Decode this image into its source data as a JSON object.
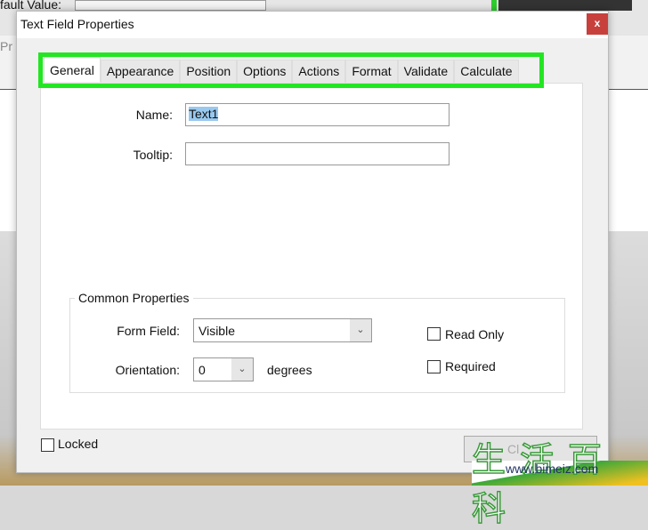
{
  "background": {
    "label": "fault Value:",
    "partial": "Pr"
  },
  "dialog": {
    "title": "Text Field Properties",
    "close_glyph": "x",
    "tabs": [
      {
        "label": "General",
        "active": true
      },
      {
        "label": "Appearance"
      },
      {
        "label": "Position"
      },
      {
        "label": "Options"
      },
      {
        "label": "Actions"
      },
      {
        "label": "Format"
      },
      {
        "label": "Validate"
      },
      {
        "label": "Calculate"
      }
    ],
    "name": {
      "label": "Name:",
      "value": "Text1"
    },
    "tooltip": {
      "label": "Tooltip:",
      "value": ""
    },
    "common": {
      "title": "Common Properties",
      "form_field": {
        "label": "Form Field:",
        "value": "Visible"
      },
      "orientation": {
        "label": "Orientation:",
        "value": "0",
        "unit": "degrees"
      },
      "read_only": {
        "label": "Read Only",
        "checked": false
      },
      "required": {
        "label": "Required",
        "checked": false
      }
    },
    "locked": {
      "label": "Locked",
      "checked": false
    },
    "close_button": "Cl"
  },
  "watermark": {
    "chars": "生活百科",
    "url": "www.bimeiz.com"
  },
  "colors": {
    "highlight": "#22e622",
    "close": "#c8403c"
  }
}
